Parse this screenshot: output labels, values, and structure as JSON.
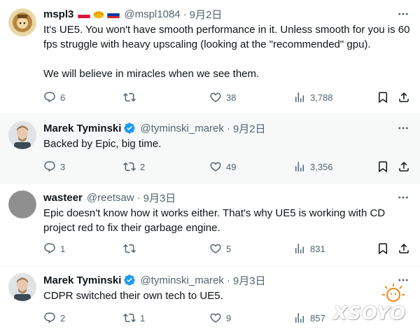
{
  "tweets": [
    {
      "name": "mspl3",
      "handle": "@mspl1084",
      "sep": "·",
      "date": "9月2日",
      "text": "It's UE5. You won't have smooth performance in it. Unless smooth for you is 60 fps struggle with heavy upscaling (looking at the \"recommended\" gpu).\n\nWe will believe in miracles when we see them.",
      "replies": "6",
      "retweets": "",
      "likes": "38",
      "views": "3,788"
    },
    {
      "name": "Marek Tyminski",
      "handle": "@tyminski_marek",
      "sep": "·",
      "date": "9月2日",
      "text": "Backed by Epic, big time.",
      "replies": "3",
      "retweets": "2",
      "likes": "49",
      "views": "3,356"
    },
    {
      "name": "wasteer",
      "handle": "@reetsaw",
      "sep": "·",
      "date": "9月3日",
      "text": "Epic doesn't know how it works either. That's why UE5 is working with CD project red to fix their garbage engine.",
      "replies": "1",
      "retweets": "",
      "likes": "5",
      "views": "831"
    },
    {
      "name": "Marek Tyminski",
      "handle": "@tyminski_marek",
      "sep": "·",
      "date": "9月3日",
      "text": "CDPR switched their own tech to UE5.",
      "replies": "2",
      "retweets": "1",
      "likes": "9",
      "views": "857"
    }
  ],
  "watermark": "XSOYO",
  "colors": {
    "text": "#0f1419",
    "secondary": "#536471",
    "verified": "#1d9bf0",
    "divider": "#eff3f4",
    "highlight_bg": "#f7f9f9"
  }
}
